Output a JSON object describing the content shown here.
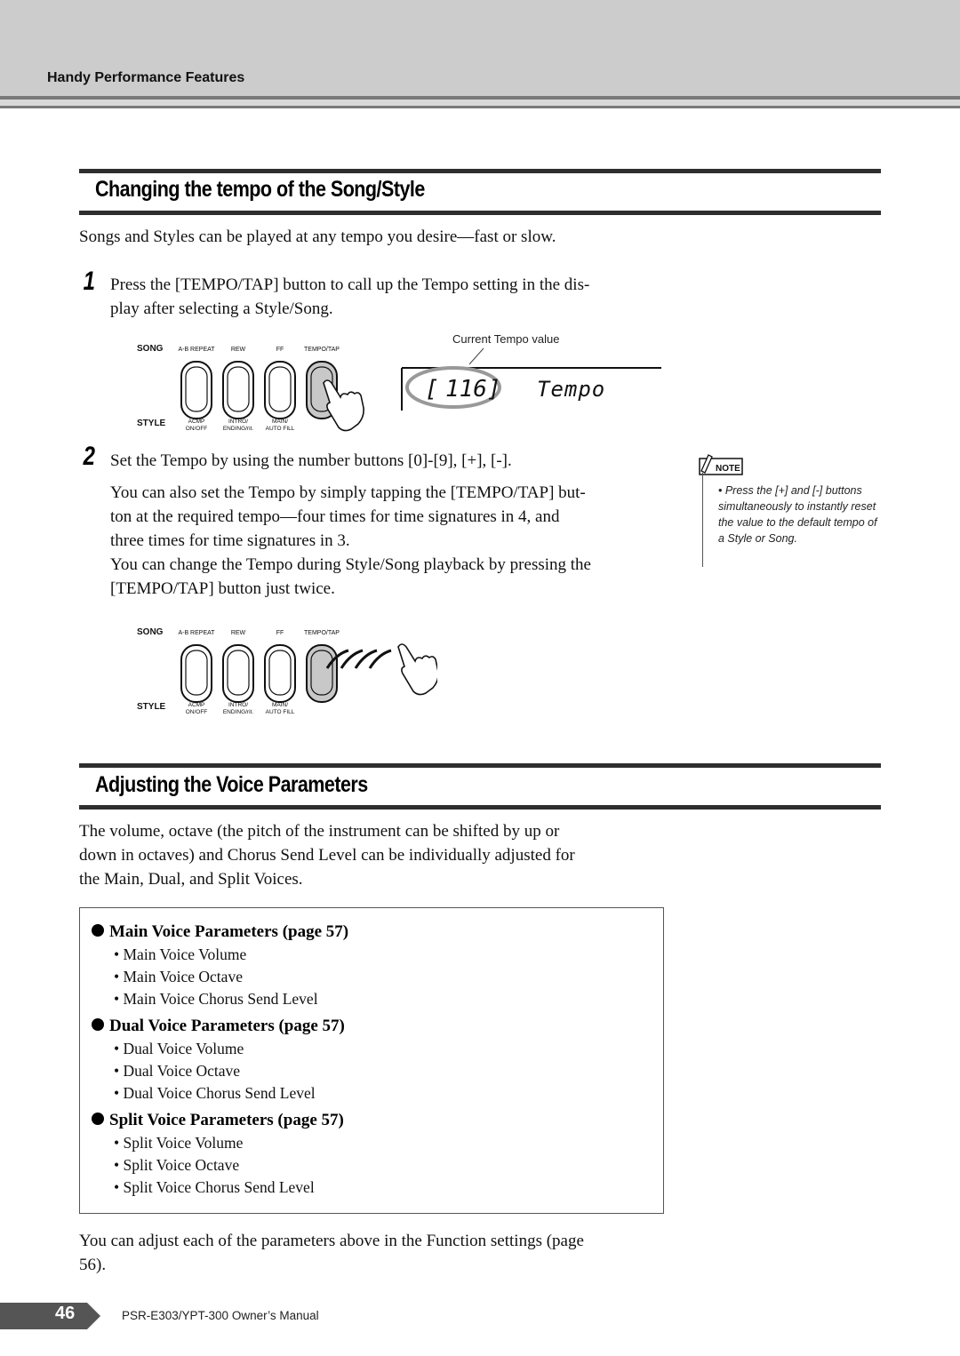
{
  "header": {
    "running_head": "Handy Performance Features"
  },
  "section1": {
    "title": "Changing the tempo of the Song/Style",
    "intro": "Songs and Styles can be played at any tempo you desire—fast or slow.",
    "step1": {
      "number": "1",
      "text_line1": "Press the [TEMPO/TAP] button to call up the Tempo setting in the dis-",
      "text_line2": "play after selecting a Style/Song."
    },
    "step2": {
      "number": "2",
      "text": "Set the Tempo by using the number buttons [0]-[9], [+], [-].",
      "para1_line1": "You can also set the Tempo by simply tapping the [TEMPO/TAP] but-",
      "para1_line2": "ton at the required tempo—four times for time signatures in 4, and",
      "para1_line3": "three times for time signatures in 3.",
      "para2_line1": "You can change the Tempo during Style/Song playback by pressing the",
      "para2_line2": "[TEMPO/TAP] button just twice."
    }
  },
  "panel": {
    "song_label": "SONG",
    "style_label": "STYLE",
    "buttons": [
      {
        "top": "A-B REPEAT",
        "bottom1": "ACMP",
        "bottom2": "ON/OFF"
      },
      {
        "top": "REW",
        "bottom1": "INTRO/",
        "bottom2": "ENDING/rit."
      },
      {
        "top": "FF",
        "bottom1": "MAIN/",
        "bottom2": "AUTO FILL"
      },
      {
        "top": "TEMPO/TAP",
        "bottom1": "",
        "bottom2": ""
      }
    ]
  },
  "display": {
    "caption": "Current Tempo value",
    "value": "116",
    "label": "Tempo"
  },
  "note": {
    "badge": "NOTE",
    "text": "•  Press the [+] and [-] buttons simultaneously to instantly reset the value to the default tempo of a Style or Song."
  },
  "section2": {
    "title": "Adjusting the Voice Parameters",
    "intro_line1": "The volume, octave (the pitch of the instrument can be shifted by up or",
    "intro_line2": "down in octaves) and Chorus Send Level can be individually adjusted for",
    "intro_line3": "the Main, Dual, and Split Voices.",
    "groups": [
      {
        "heading": "Main Voice Parameters (page 57)",
        "items": [
          "• Main Voice Volume",
          "• Main Voice Octave",
          "• Main Voice Chorus Send Level"
        ]
      },
      {
        "heading": "Dual Voice Parameters (page 57)",
        "items": [
          "• Dual Voice Volume",
          "• Dual Voice Octave",
          "• Dual Voice Chorus Send Level"
        ]
      },
      {
        "heading": "Split Voice Parameters (page 57)",
        "items": [
          "• Split Voice Volume",
          "• Split Voice Octave",
          "• Split Voice Chorus Send Level"
        ]
      }
    ],
    "outro_line1": "You can adjust each of the parameters above in the Function settings (page",
    "outro_line2": "56)."
  },
  "footer": {
    "page_number": "46",
    "manual_name": "PSR-E303/YPT-300   Owner’s Manual"
  },
  "colors": {
    "band": "#cccccc",
    "rule": "#2e2e2e",
    "pressed_button": "#c8c8c8",
    "page_tab": "#555555"
  }
}
